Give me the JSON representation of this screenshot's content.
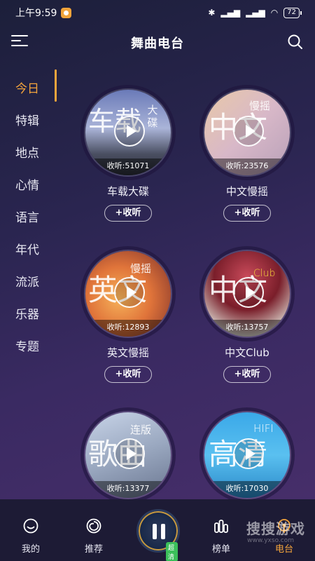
{
  "status_bar": {
    "time": "上午9:59",
    "battery": "72"
  },
  "header": {
    "title": "舞曲电台"
  },
  "sidebar": {
    "items": [
      {
        "label": "今日",
        "active": true
      },
      {
        "label": "特辑"
      },
      {
        "label": "地点"
      },
      {
        "label": "心情"
      },
      {
        "label": "语言"
      },
      {
        "label": "年代"
      },
      {
        "label": "流派"
      },
      {
        "label": "乐器"
      },
      {
        "label": "专题"
      }
    ]
  },
  "cards": [
    {
      "title": "车载大碟",
      "listen": "收听:51071",
      "add_label": "+收听",
      "art_main": "车载",
      "art_sub": "大碟"
    },
    {
      "title": "中文慢摇",
      "listen": "收听:23576",
      "add_label": "+收听",
      "art_main": "中文",
      "art_sub": "慢摇"
    },
    {
      "title": "英文慢摇",
      "listen": "收听:12893",
      "add_label": "+收听",
      "art_main": "英文",
      "art_sub": "慢摇"
    },
    {
      "title": "中文Club",
      "listen": "收听:13757",
      "add_label": "+收听",
      "art_main": "中文",
      "art_sub": "Club"
    },
    {
      "title": "",
      "listen": "收听:13377",
      "add_label": "",
      "art_main": "歌曲",
      "art_sub": "连版"
    },
    {
      "title": "",
      "listen": "收听:17030",
      "add_label": "",
      "art_main": "高清",
      "art_sub": "HIFI"
    }
  ],
  "bottom_nav": {
    "items": [
      {
        "label": "我的"
      },
      {
        "label": "推荐"
      },
      {
        "label": "榜单"
      },
      {
        "label": "电台",
        "active": true
      }
    ],
    "player_badge": "超清"
  },
  "watermark": {
    "text": "搜搜游戏",
    "sub": "www.yxso.com"
  }
}
